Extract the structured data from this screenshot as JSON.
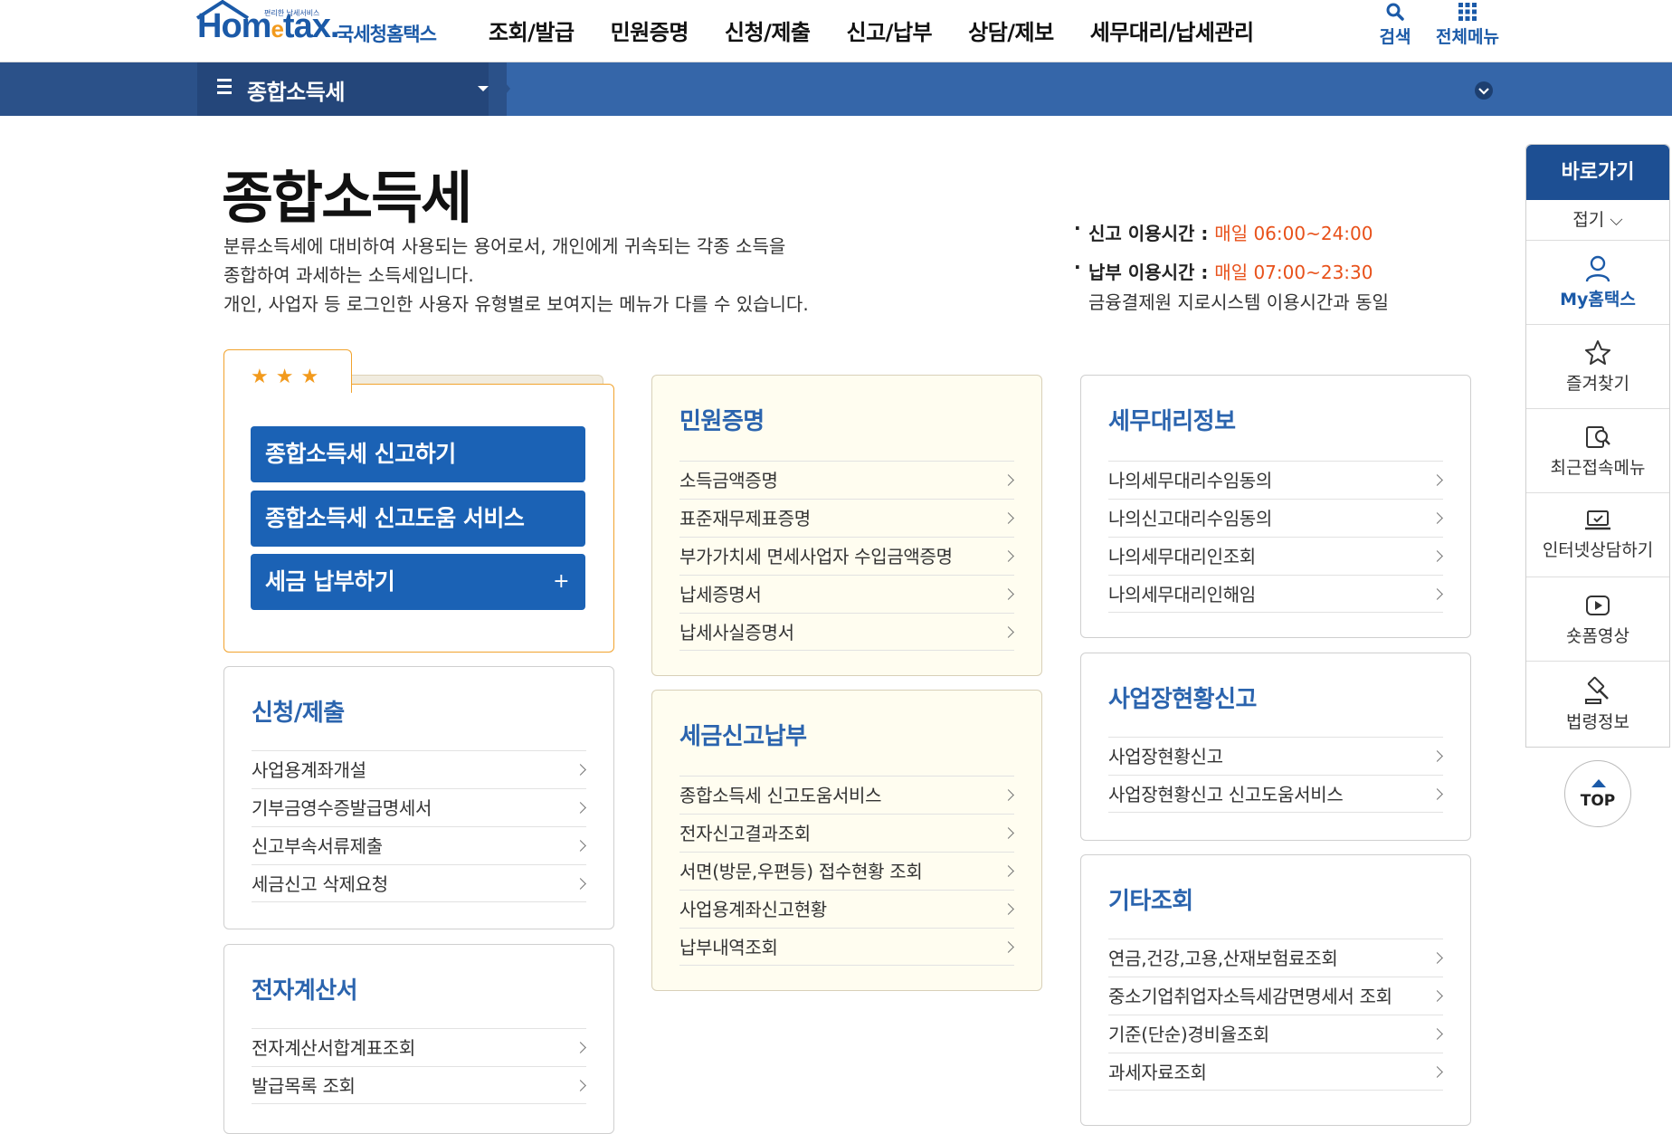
{
  "header": {
    "logo_tagline": "편리한 납세서비스",
    "logo_brand_a": "Hom",
    "logo_brand_e": "e",
    "logo_brand_b": "tax.",
    "logo_korean": "국세청홈택스",
    "gnb": [
      "조회/발급",
      "민원증명",
      "신청/제출",
      "신고/납부",
      "상담/제보",
      "세무대리/납세관리"
    ],
    "search_label": "검색",
    "menu_label": "전체메뉴"
  },
  "subnav": {
    "title": "종합소득세"
  },
  "page": {
    "title": "종합소득세",
    "intro": [
      "분류소득세에 대비하여 사용되는 용어로서, 개인에게 귀속되는 각종 소득을",
      "종합하여 과세하는 소득세입니다.",
      "개인, 사업자 등 로그인한 사용자 유형별로 보여지는 메뉴가 다를 수 있습니다."
    ],
    "hours": {
      "report_label": "신고 이용시간 : ",
      "report_time": "매일 06:00~24:00",
      "pay_label": "납부 이용시간 : ",
      "pay_time": "매일 07:00~23:30",
      "pay_note": "금융결제원 지로시스템 이용시간과 동일"
    }
  },
  "favorites": {
    "stars": "★★★",
    "buttons": [
      "종합소득세 신고하기",
      "종합소득세 신고도움 서비스",
      "세금 납부하기"
    ],
    "plus": "+"
  },
  "cards": {
    "apply": {
      "title": "신청/제출",
      "items": [
        "사업용계좌개설",
        "기부금영수증발급명세서",
        "신고부속서류제출",
        "세금신고 삭제요청"
      ]
    },
    "einvoice": {
      "title": "전자계산서",
      "items": [
        "전자계산서합계표조회",
        "발급목록 조회"
      ]
    },
    "civil": {
      "title": "민원증명",
      "items": [
        "소득금액증명",
        "표준재무제표증명",
        "부가가치세 면세사업자 수입금액증명",
        "납세증명서",
        "납세사실증명서"
      ]
    },
    "taxreport": {
      "title": "세금신고납부",
      "items": [
        "종합소득세 신고도움서비스",
        "전자신고결과조회",
        "서면(방문,우편등) 접수현황 조회",
        "사업용계좌신고현황",
        "납부내역조회"
      ]
    },
    "agent": {
      "title": "세무대리정보",
      "items": [
        "나의세무대리수임동의",
        "나의신고대리수임동의",
        "나의세무대리인조회",
        "나의세무대리인해임"
      ]
    },
    "bizstatus": {
      "title": "사업장현황신고",
      "items": [
        "사업장현황신고",
        "사업장현황신고 신고도움서비스"
      ]
    },
    "etc": {
      "title": "기타조회",
      "items": [
        "연금,건강,고용,산재보험료조회",
        "중소기업취업자소득세감면명세서 조회",
        "기준(단순)경비율조회",
        "과세자료조회"
      ]
    }
  },
  "quick": {
    "title": "바로가기",
    "fold": "접기",
    "items": [
      "My홈택스",
      "즐겨찾기",
      "최근접속메뉴",
      "인터넷상담하기",
      "숏폼영상",
      "법령정보"
    ]
  },
  "top_button": "TOP",
  "colors": {
    "brand_blue": "#1b62b5",
    "nav_dark": "#24467a",
    "accent_orange": "#f1a32e",
    "time_red": "#e8511a"
  }
}
